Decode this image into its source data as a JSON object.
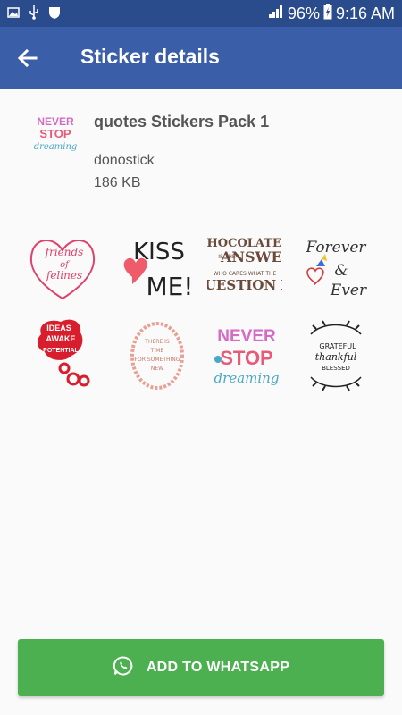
{
  "status_bar": {
    "battery": "96%",
    "time": "9:16 AM"
  },
  "toolbar": {
    "title": "Sticker details"
  },
  "pack": {
    "name": "quotes Stickers Pack 1",
    "publisher": "donostick",
    "size": "186 KB",
    "tray_text": [
      "NEVER",
      "STOP",
      "dreaming"
    ]
  },
  "stickers": [
    {
      "name": "sticker-friends-of-felines",
      "lines": [
        "friends",
        "of",
        "felines"
      ]
    },
    {
      "name": "sticker-kiss-me",
      "lines": [
        "KISS",
        "ME!"
      ]
    },
    {
      "name": "sticker-chocolate-answer",
      "lines": [
        "CHOCOLATE",
        "IS THE",
        "ANSWER",
        "WHO CARES WHAT THE",
        "QUESTION IS"
      ]
    },
    {
      "name": "sticker-forever-and-ever",
      "lines": [
        "Forever",
        "&",
        "Ever"
      ]
    },
    {
      "name": "sticker-ideas-potential",
      "lines": [
        "IDEAS",
        "AWAKE",
        "POTENTIAL"
      ]
    },
    {
      "name": "sticker-floral-wreath",
      "lines": [
        "THERE IS",
        "TIME",
        "FOR SOMETHING",
        "NEW"
      ]
    },
    {
      "name": "sticker-never-stop-dreaming",
      "lines": [
        "NEVER",
        "STOP",
        "dreaming"
      ]
    },
    {
      "name": "sticker-grateful-thankful-blessed",
      "lines": [
        "GRATEFUL",
        "thankful",
        "BLESSED"
      ]
    }
  ],
  "action": {
    "label": "ADD TO WHATSAPP"
  },
  "colors": {
    "status_bar": "#2b4c8c",
    "toolbar": "#3b5ea8",
    "button": "#4cb050"
  }
}
